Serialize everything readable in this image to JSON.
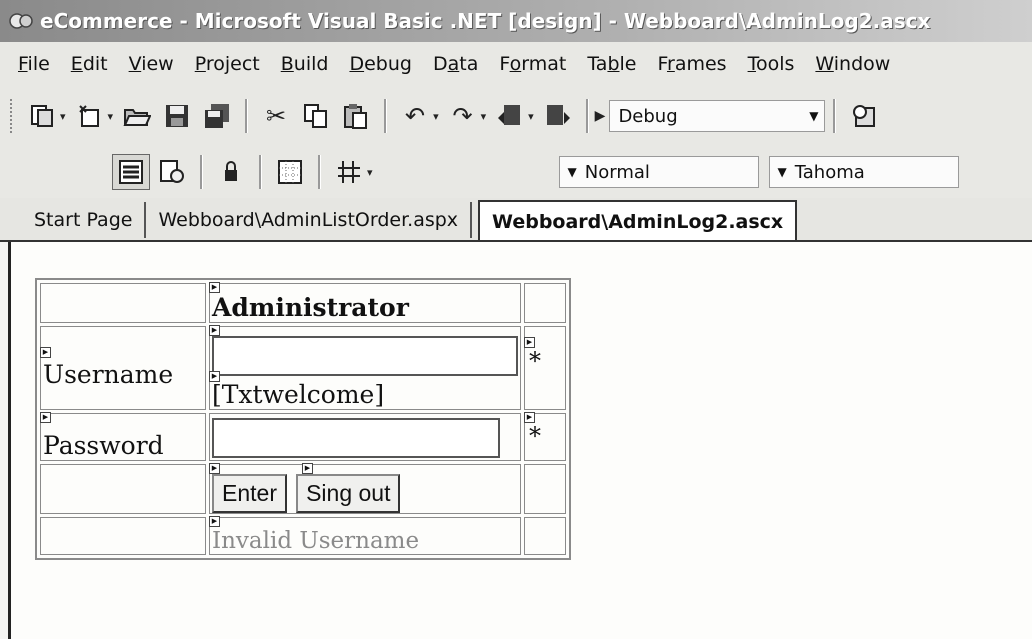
{
  "window": {
    "title": "eCommerce - Microsoft Visual Basic .NET [design] - Webboard\\AdminLog2.ascx"
  },
  "menubar": {
    "items": [
      {
        "label": "File",
        "mnemonic": "F"
      },
      {
        "label": "Edit",
        "mnemonic": "E"
      },
      {
        "label": "View",
        "mnemonic": "V"
      },
      {
        "label": "Project",
        "mnemonic": "P"
      },
      {
        "label": "Build",
        "mnemonic": "B"
      },
      {
        "label": "Debug",
        "mnemonic": "D"
      },
      {
        "label": "Data",
        "mnemonic": "a"
      },
      {
        "label": "Format",
        "mnemonic": "o"
      },
      {
        "label": "Table",
        "mnemonic": "b"
      },
      {
        "label": "Frames",
        "mnemonic": "r"
      },
      {
        "label": "Tools",
        "mnemonic": "T"
      },
      {
        "label": "Window",
        "mnemonic": "W"
      }
    ]
  },
  "toolbar": {
    "config_combo": "Debug",
    "block_format_combo": "Normal",
    "font_combo": "Tahoma"
  },
  "tabs": [
    {
      "label": "Start Page",
      "active": false
    },
    {
      "label": "Webboard\\AdminListOrder.aspx",
      "active": false
    },
    {
      "label": "Webboard\\AdminLog2.ascx",
      "active": true
    }
  ],
  "form": {
    "heading": "Administrator",
    "username_label": "Username",
    "password_label": "Password",
    "welcome_label": "[Txtwelcome]",
    "required_marker": "*",
    "enter_button": "Enter",
    "signout_button": "Sing out",
    "invalid_message": "Invalid Username"
  }
}
